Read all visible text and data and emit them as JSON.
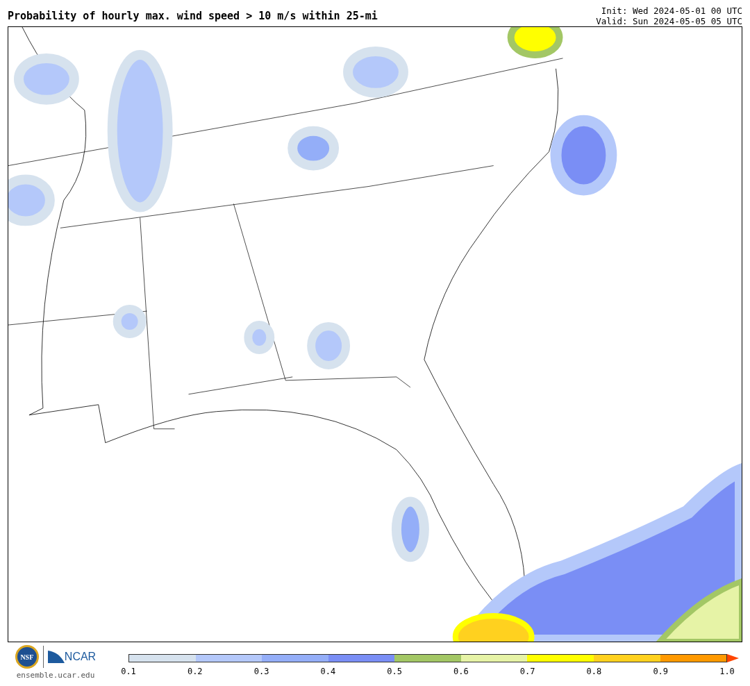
{
  "title": "Probability of hourly max. wind speed > 10 m/s within 25-mi",
  "init": "Init: Wed 2024-05-01 00 UTC",
  "valid": "Valid: Sun 2024-05-05 05 UTC",
  "logos": {
    "nsf": "NSF",
    "ncar": "NCAR"
  },
  "site": "ensemble.ucar.edu",
  "colorbar": {
    "bins": [
      {
        "color": "#d6e2ee"
      },
      {
        "color": "#b4c8fa"
      },
      {
        "color": "#94aef8"
      },
      {
        "color": "#7a8ef5"
      },
      {
        "color": "#a3c765"
      },
      {
        "color": "#e6f3a6"
      },
      {
        "color": "#ffff00"
      },
      {
        "color": "#ffd11f"
      },
      {
        "color": "#ff9900"
      }
    ],
    "extend_arrow": {
      "color": "#ff4500"
    },
    "ticks": [
      "0.1",
      "0.2",
      "0.3",
      "0.4",
      "0.5",
      "0.6",
      "0.7",
      "0.8",
      "0.9",
      "1.0"
    ]
  }
}
